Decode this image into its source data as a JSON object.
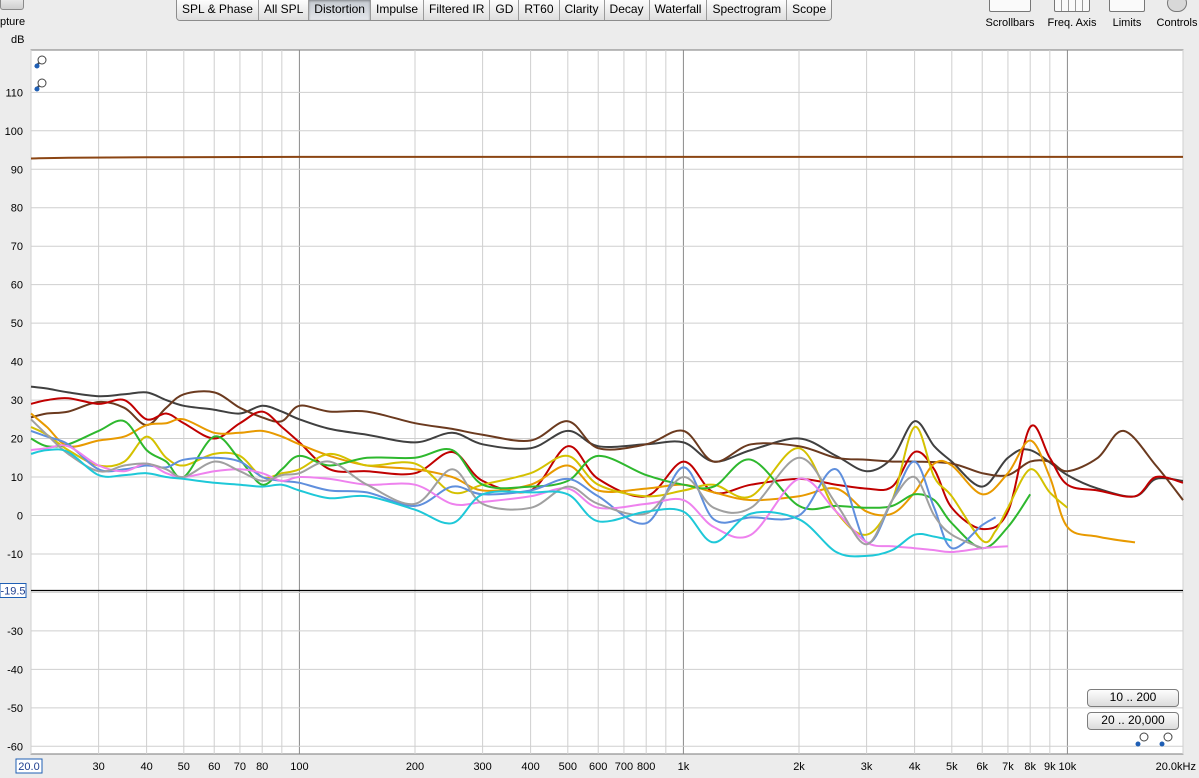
{
  "toolbar": {
    "capture_label": "pture",
    "tabs": [
      "SPL & Phase",
      "All SPL",
      "Distortion",
      "Impulse",
      "Filtered IR",
      "GD",
      "RT60",
      "Clarity",
      "Decay",
      "Waterfall",
      "Spectrogram",
      "Scope"
    ],
    "active_tab": "Distortion",
    "tools": [
      "Scrollbars",
      "Freq. Axis",
      "Limits",
      "Controls"
    ]
  },
  "range_buttons": [
    "10 .. 200",
    "20 .. 20,000"
  ],
  "chart_data": {
    "type": "line",
    "title": "",
    "ylabel": "dB",
    "xscale": "log",
    "xlim": [
      20,
      20000
    ],
    "ylim": [
      -62,
      121
    ],
    "y_ticks": [
      110,
      100,
      90,
      80,
      70,
      60,
      50,
      40,
      30,
      20,
      10,
      0,
      -10,
      -20,
      -30,
      -40,
      -50,
      -60
    ],
    "x_tick_labels": [
      {
        "f": 20,
        "label": "20.0"
      },
      {
        "f": 30,
        "label": "30"
      },
      {
        "f": 40,
        "label": "40"
      },
      {
        "f": 50,
        "label": "50"
      },
      {
        "f": 60,
        "label": "60"
      },
      {
        "f": 70,
        "label": "70"
      },
      {
        "f": 80,
        "label": "80"
      },
      {
        "f": 100,
        "label": "100"
      },
      {
        "f": 200,
        "label": "200"
      },
      {
        "f": 300,
        "label": "300"
      },
      {
        "f": 400,
        "label": "400"
      },
      {
        "f": 500,
        "label": "500"
      },
      {
        "f": 600,
        "label": "600"
      },
      {
        "f": 700,
        "label": "700"
      },
      {
        "f": 800,
        "label": "800"
      },
      {
        "f": 1000,
        "label": "1k"
      },
      {
        "f": 2000,
        "label": "2k"
      },
      {
        "f": 3000,
        "label": "3k"
      },
      {
        "f": 4000,
        "label": "4k"
      },
      {
        "f": 5000,
        "label": "5k"
      },
      {
        "f": 6000,
        "label": "6k"
      },
      {
        "f": 7000,
        "label": "7k"
      },
      {
        "f": 8000,
        "label": "8k"
      },
      {
        "f": 9000,
        "label": "9k"
      },
      {
        "f": 10000,
        "label": "10k"
      },
      {
        "f": 20000,
        "label": "20.0kHz"
      }
    ],
    "cursor": {
      "y": -19.5,
      "label": "-19.5"
    },
    "grid": true,
    "legend": "none",
    "series": [
      {
        "color": "#8b4513",
        "x": [
          20,
          25,
          40,
          100,
          1000,
          10000,
          20000
        ],
        "y": [
          92.8,
          93.0,
          93.1,
          93.2,
          93.2,
          93.2,
          93.2
        ]
      },
      {
        "color": "#404040",
        "x": [
          20,
          22,
          25,
          30,
          35,
          40,
          45,
          50,
          60,
          70,
          80,
          90,
          100,
          120,
          150,
          200,
          250,
          300,
          400,
          500,
          600,
          800,
          1000,
          1200,
          1500,
          2000,
          2500,
          3000,
          3500,
          4000,
          4500,
          5000,
          6000,
          7000,
          8000,
          10000,
          12000,
          15000,
          17000,
          20000
        ],
        "y": [
          33.5,
          33.0,
          32.0,
          31.0,
          31.5,
          32.0,
          30.0,
          28.5,
          27.5,
          26.5,
          28.5,
          27.0,
          25.0,
          22.5,
          21.0,
          19.0,
          21.5,
          18.5,
          17.5,
          22.0,
          18.0,
          18.5,
          19.0,
          14.0,
          17.0,
          20.0,
          15.5,
          11.5,
          15.0,
          24.5,
          18.0,
          14.0,
          7.5,
          15.0,
          17.0,
          10.5,
          7.0,
          5.0,
          9.5,
          9.0
        ]
      },
      {
        "color": "#6b3a1f",
        "x": [
          20,
          22,
          25,
          30,
          35,
          40,
          45,
          50,
          60,
          70,
          80,
          90,
          100,
          120,
          150,
          200,
          250,
          300,
          400,
          500,
          600,
          800,
          1000,
          1200,
          1500,
          2000,
          2500,
          3000,
          3500,
          4000,
          5000,
          6000,
          7000,
          8000,
          9000,
          10000,
          12000,
          14000,
          17000,
          20000
        ],
        "y": [
          25.5,
          26.5,
          27.0,
          29.5,
          28.0,
          23.5,
          28.0,
          31.5,
          32.0,
          28.0,
          25.5,
          24.5,
          28.5,
          27.0,
          27.0,
          24.0,
          22.5,
          21.0,
          19.5,
          24.5,
          17.5,
          18.5,
          22.0,
          14.0,
          18.5,
          18.0,
          15.0,
          14.5,
          14.0,
          14.0,
          13.5,
          11.0,
          10.5,
          14.0,
          14.0,
          11.5,
          15.0,
          22.0,
          13.0,
          4.0
        ]
      },
      {
        "color": "#c00000",
        "x": [
          20,
          22,
          25,
          30,
          35,
          40,
          45,
          50,
          60,
          70,
          80,
          90,
          100,
          120,
          150,
          200,
          250,
          300,
          400,
          500,
          600,
          800,
          1000,
          1200,
          1500,
          2000,
          2500,
          3000,
          3500,
          4000,
          4500,
          5000,
          6000,
          7000,
          8000,
          9000,
          10000,
          12000,
          15000,
          17000,
          20000
        ],
        "y": [
          29.0,
          30.0,
          30.5,
          29.0,
          30.0,
          25.0,
          26.5,
          24.0,
          20.0,
          24.0,
          27.0,
          23.0,
          19.0,
          12.0,
          11.5,
          11.0,
          16.5,
          9.0,
          6.5,
          18.0,
          9.5,
          5.0,
          14.0,
          6.0,
          8.0,
          9.5,
          8.0,
          7.0,
          7.5,
          16.5,
          12.0,
          2.0,
          -3.5,
          1.0,
          23.0,
          15.0,
          8.0,
          6.5,
          5.0,
          10.0,
          8.5
        ]
      },
      {
        "color": "#e89a00",
        "x": [
          20,
          22,
          25,
          30,
          35,
          40,
          45,
          50,
          60,
          70,
          80,
          90,
          100,
          120,
          150,
          200,
          250,
          300,
          400,
          500,
          600,
          800,
          1000,
          1200,
          1500,
          2000,
          2500,
          3000,
          3500,
          4000,
          4500,
          5000,
          6000,
          7000,
          8000,
          9000,
          10000,
          12000,
          15000
        ],
        "y": [
          26.5,
          23.0,
          18.0,
          19.5,
          20.5,
          23.5,
          24.0,
          25.0,
          21.5,
          21.5,
          22.0,
          20.5,
          18.5,
          15.5,
          13.0,
          12.0,
          10.0,
          6.5,
          8.0,
          13.0,
          6.5,
          7.0,
          8.0,
          6.0,
          4.0,
          5.0,
          7.0,
          1.0,
          0.5,
          6.0,
          13.5,
          13.0,
          5.5,
          11.0,
          19.5,
          10.0,
          -3.0,
          -5.5,
          -7.0
        ]
      },
      {
        "color": "#d4c100",
        "x": [
          20,
          22,
          25,
          30,
          35,
          40,
          45,
          50,
          60,
          70,
          80,
          90,
          100,
          120,
          150,
          200,
          250,
          300,
          400,
          500,
          600,
          800,
          1000,
          1200,
          1500,
          2000,
          2500,
          3000,
          3500,
          4000,
          4500,
          5000,
          6000,
          6500,
          7000,
          8000,
          9000,
          10000
        ],
        "y": [
          23.0,
          21.0,
          17.0,
          13.0,
          14.0,
          20.5,
          15.0,
          13.0,
          16.0,
          15.5,
          10.0,
          11.0,
          12.0,
          16.0,
          13.0,
          13.5,
          6.0,
          8.0,
          11.0,
          15.5,
          8.0,
          5.0,
          6.5,
          8.0,
          5.0,
          17.5,
          1.0,
          -5.0,
          4.0,
          23.0,
          10.0,
          5.0,
          -6.5,
          -4.0,
          2.0,
          12.0,
          6.0,
          2.0
        ]
      },
      {
        "color": "#2eb82e",
        "x": [
          20,
          22,
          25,
          30,
          35,
          40,
          45,
          50,
          60,
          70,
          80,
          90,
          100,
          120,
          150,
          200,
          250,
          300,
          400,
          500,
          600,
          800,
          1000,
          1200,
          1500,
          2000,
          2500,
          3000,
          3500,
          4000,
          4500,
          5000,
          6000,
          7000,
          8000
        ],
        "y": [
          20.0,
          18.0,
          18.5,
          22.0,
          24.5,
          17.0,
          14.0,
          10.0,
          20.5,
          14.5,
          8.0,
          12.0,
          15.5,
          13.0,
          15.0,
          15.0,
          17.0,
          8.0,
          7.5,
          9.0,
          15.5,
          10.5,
          8.0,
          7.5,
          14.5,
          2.5,
          2.5,
          2.0,
          2.5,
          5.5,
          4.0,
          -2.0,
          -8.5,
          -3.0,
          5.5
        ]
      },
      {
        "color": "#5f8fdd",
        "x": [
          20,
          22,
          25,
          30,
          35,
          40,
          45,
          50,
          60,
          70,
          80,
          90,
          100,
          120,
          150,
          200,
          250,
          300,
          400,
          500,
          600,
          800,
          1000,
          1200,
          1500,
          2000,
          2500,
          3000,
          3500,
          4000,
          4500,
          5000,
          6000,
          6500
        ],
        "y": [
          22.0,
          20.5,
          18.5,
          12.0,
          12.0,
          13.0,
          12.5,
          14.5,
          15.0,
          14.0,
          10.0,
          9.0,
          8.5,
          6.5,
          6.0,
          2.5,
          7.5,
          5.5,
          6.5,
          9.5,
          5.0,
          -2.0,
          12.5,
          -1.0,
          -0.5,
          0.0,
          12.0,
          -7.0,
          4.0,
          14.0,
          2.0,
          -8.5,
          -2.5,
          -0.5
        ]
      },
      {
        "color": "#ee82ee",
        "x": [
          20,
          22,
          25,
          30,
          35,
          40,
          45,
          50,
          60,
          70,
          80,
          90,
          100,
          120,
          150,
          200,
          250,
          300,
          400,
          500,
          600,
          800,
          1000,
          1200,
          1500,
          2000,
          2500,
          3000,
          3500,
          4000,
          4500,
          5000,
          6000,
          7000
        ],
        "y": [
          17.0,
          17.5,
          18.0,
          13.0,
          11.5,
          13.5,
          11.0,
          10.0,
          11.5,
          12.0,
          11.0,
          9.0,
          10.0,
          9.5,
          8.0,
          8.0,
          3.0,
          3.5,
          5.0,
          7.0,
          2.0,
          3.0,
          4.0,
          -3.0,
          -5.0,
          9.5,
          1.0,
          -7.0,
          -8.0,
          -8.5,
          -9.0,
          -9.5,
          -8.5,
          -8.0
        ]
      },
      {
        "color": "#a0a0a0",
        "x": [
          20,
          22,
          25,
          30,
          35,
          40,
          45,
          50,
          60,
          70,
          80,
          90,
          100,
          120,
          150,
          200,
          250,
          300,
          400,
          500,
          600,
          800,
          1000,
          1200,
          1500,
          2000,
          2500,
          3000,
          3500,
          4000,
          4500,
          5000,
          6000
        ],
        "y": [
          25.0,
          21.0,
          16.0,
          11.5,
          13.0,
          13.5,
          12.0,
          10.0,
          14.0,
          11.5,
          9.0,
          10.5,
          11.0,
          14.0,
          8.0,
          3.0,
          12.0,
          3.0,
          2.0,
          7.5,
          3.0,
          0.5,
          10.0,
          2.0,
          2.0,
          15.0,
          3.0,
          -7.5,
          4.0,
          10.0,
          0.0,
          -5.0,
          -8.5
        ]
      },
      {
        "color": "#1ec8d8",
        "x": [
          20,
          22,
          25,
          30,
          35,
          40,
          45,
          50,
          60,
          70,
          80,
          90,
          100,
          120,
          150,
          200,
          250,
          300,
          400,
          500,
          600,
          800,
          1000,
          1200,
          1500,
          2000,
          2500,
          3000,
          3500,
          4000,
          4500,
          5000
        ],
        "y": [
          16.0,
          17.0,
          16.5,
          10.5,
          10.5,
          11.0,
          10.0,
          9.5,
          8.5,
          8.0,
          7.5,
          8.0,
          6.5,
          4.5,
          5.0,
          1.5,
          -2.0,
          5.5,
          6.0,
          5.5,
          -1.5,
          1.0,
          1.0,
          -7.0,
          0.5,
          -1.0,
          -9.5,
          -10.5,
          -9.0,
          -5.0,
          -5.5,
          -6.5
        ]
      }
    ]
  }
}
